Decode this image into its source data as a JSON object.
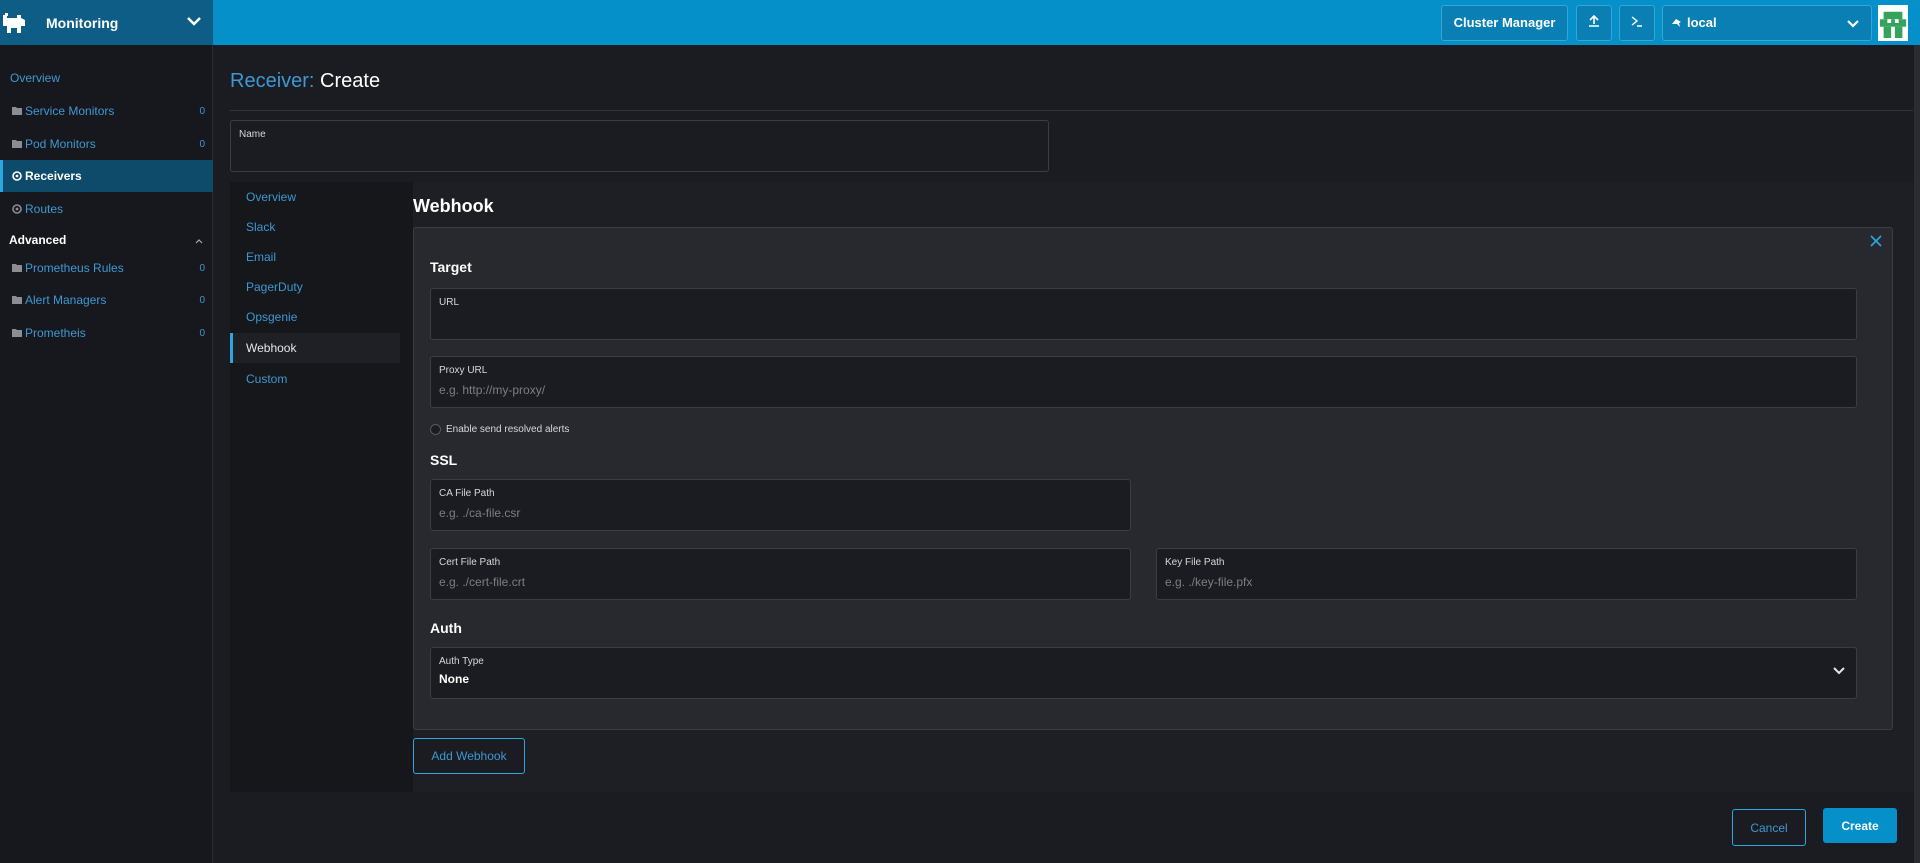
{
  "header": {
    "product": "Monitoring",
    "cluster_manager_label": "Cluster Manager",
    "cluster_name": "local",
    "colors": {
      "header": "#0590c9",
      "brand": "#0d5d87"
    }
  },
  "sidebar": {
    "items": [
      {
        "label": "Overview",
        "count": ""
      },
      {
        "label": "Service Monitors",
        "count": "0"
      },
      {
        "label": "Pod Monitors",
        "count": "0"
      },
      {
        "label": "Receivers",
        "count": ""
      },
      {
        "label": "Routes",
        "count": ""
      }
    ],
    "group_label": "Advanced",
    "group_items": [
      {
        "label": "Prometheus Rules",
        "count": "0"
      },
      {
        "label": "Alert Managers",
        "count": "0"
      },
      {
        "label": "Prometheis",
        "count": "0"
      }
    ]
  },
  "page": {
    "title_prefix": "Receiver:",
    "title_action": "Create",
    "name_label": "Name",
    "name_value": ""
  },
  "tabs": [
    "Overview",
    "Slack",
    "Email",
    "PagerDuty",
    "Opsgenie",
    "Webhook",
    "Custom"
  ],
  "webhook": {
    "section_title": "Webhook",
    "target_heading": "Target",
    "url_label": "URL",
    "url_value": "",
    "proxy_label": "Proxy URL",
    "proxy_placeholder": "e.g. http://my-proxy/",
    "resolved_label": "Enable send resolved alerts",
    "ssl_heading": "SSL",
    "ca_label": "CA File Path",
    "ca_placeholder": "e.g. ./ca-file.csr",
    "cert_label": "Cert File Path",
    "cert_placeholder": "e.g. ./cert-file.crt",
    "key_label": "Key File Path",
    "key_placeholder": "e.g. ./key-file.pfx",
    "auth_heading": "Auth",
    "auth_type_label": "Auth Type",
    "auth_type_value": "None",
    "add_label": "Add Webhook"
  },
  "footer": {
    "cancel_label": "Cancel",
    "create_label": "Create"
  }
}
